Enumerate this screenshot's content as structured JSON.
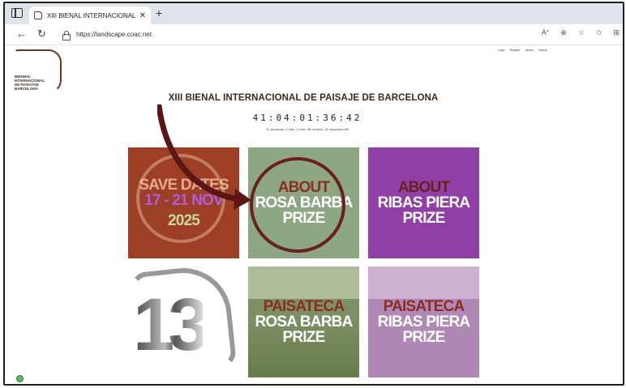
{
  "browser": {
    "tab_title": "XIII BIENAL INTERNACIONAL DE",
    "url": "https://landscape.coac.net"
  },
  "page": {
    "logo_lines": [
      "BIENNAL",
      "INTERNACIONAL",
      "DE PAISATGE",
      "BARCELONA"
    ],
    "top_links": [
      "Login",
      "Register",
      "Idioma",
      "Search"
    ],
    "title": "XIII BIENAL INTERNACIONAL DE PAISAJE DE BARCELONA",
    "countdown": "41:04:01:36:42",
    "countdown_sub": "41 semanas, 4 días, 1 hora, 36 minutos, 42 segundos left"
  },
  "tiles": [
    {
      "lines": [
        "SAVE DATES",
        "17 - 21 NOV",
        "2025"
      ],
      "colors": [
        "#e8a98e",
        "#b15be0",
        "#c9d8a0"
      ]
    },
    {
      "lines": [
        "ABOUT",
        "ROSA BARBA",
        "PRIZE"
      ],
      "colors": [
        "#8a2d22",
        "#ffffff",
        "#ffffff"
      ]
    },
    {
      "lines": [
        "ABOUT",
        "RIBAS PIERA",
        "PRIZE"
      ],
      "colors": [
        "#6b1f1f",
        "#ffffff",
        "#ffffff"
      ]
    },
    {
      "lines": [
        "13"
      ]
    },
    {
      "lines": [
        "PAISATECA",
        "ROSA BARBA",
        "PRIZE"
      ],
      "colors": [
        "#8a2d22",
        "#ffffff",
        "#ffffff"
      ]
    },
    {
      "lines": [
        "PAISATECA",
        "RIBAS PIERA",
        "PRIZE"
      ],
      "colors": [
        "#8a2d22",
        "#ffffff",
        "#ffffff"
      ]
    }
  ],
  "colors": {
    "accent_brown": "#6b3a20",
    "tile_red": "#9c3f24",
    "tile_sage": "#8ca781",
    "tile_purple": "#8f3fa6"
  }
}
